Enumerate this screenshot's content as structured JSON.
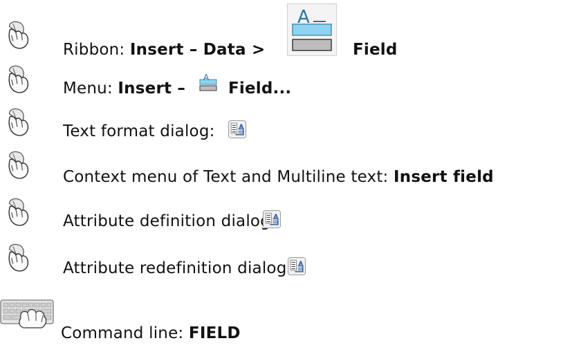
{
  "items": [
    {
      "icon": "mouse-icon",
      "label": "Ribbon: ",
      "bold1": "Insert – Data >",
      "bold2": "Field"
    },
    {
      "icon": "mouse-icon",
      "label": "Menu: ",
      "bold1": "Insert –",
      "bold2": "Field..."
    },
    {
      "icon": "mouse-icon",
      "label": "Text format dialog:"
    },
    {
      "icon": "mouse-icon",
      "label": "Context menu of Text and Multiline text: ",
      "bold1": "Insert field"
    },
    {
      "icon": "mouse-icon",
      "label": "Attribute definition dialog:"
    },
    {
      "icon": "mouse-icon",
      "label": "Attribute redefinition dialog:"
    },
    {
      "icon": "keyboard-icon",
      "label": "Command line: ",
      "bold1": "FIELD"
    }
  ],
  "icons": {
    "field_large": "insert-field-icon",
    "field_small": "insert-field-icon",
    "field_dialog": "insert-field-button-icon"
  },
  "colors": {
    "text": "#111111",
    "field_icon_blue": "#8fd3f2",
    "field_icon_gray": "#bdbdbd"
  }
}
